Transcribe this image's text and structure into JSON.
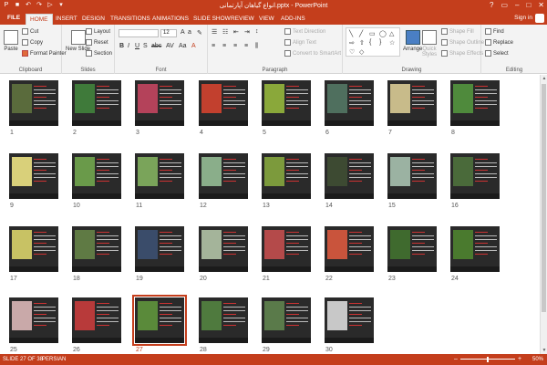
{
  "window": {
    "title": "انواع گیاهان آپارتمانی.pptx - PowerPoint",
    "controls": [
      "?",
      "▭",
      "–",
      "□",
      "✕"
    ]
  },
  "tabs": [
    "FILE",
    "HOME",
    "INSERT",
    "DESIGN",
    "TRANSITIONS",
    "ANIMATIONS",
    "SLIDE SHOW",
    "REVIEW",
    "VIEW",
    "ADD-INS"
  ],
  "signin": "Sign in",
  "ribbon": {
    "clipboard": {
      "label": "Clipboard",
      "paste": "Paste",
      "cut": "Cut",
      "copy": "Copy",
      "format_painter": "Format Painter"
    },
    "slides": {
      "label": "Slides",
      "new_slide": "New Slide",
      "layout": "Layout",
      "reset": "Reset",
      "section": "Section"
    },
    "font": {
      "label": "Font",
      "size": "12",
      "buttons": [
        "B",
        "I",
        "U",
        "S",
        "abc",
        "AV",
        "Aa",
        "A"
      ]
    },
    "paragraph": {
      "label": "Paragraph",
      "text_direction": "Text Direction",
      "align_text": "Align Text",
      "convert": "Convert to SmartArt"
    },
    "drawing": {
      "label": "Drawing",
      "arrange": "Arrange",
      "quick_styles": "Quick Styles",
      "shape_fill": "Shape Fill",
      "shape_outline": "Shape Outline",
      "shape_effects": "Shape Effects"
    },
    "editing": {
      "label": "Editing",
      "find": "Find",
      "replace": "Replace",
      "select": "Select"
    }
  },
  "slides": [
    {
      "n": "1",
      "color": "#5a6b3c"
    },
    {
      "n": "2",
      "color": "#3f7a3a"
    },
    {
      "n": "3",
      "color": "#b4425a"
    },
    {
      "n": "4",
      "color": "#c2402e"
    },
    {
      "n": "5",
      "color": "#8aa83a"
    },
    {
      "n": "6",
      "color": "#4f6f5e"
    },
    {
      "n": "7",
      "color": "#c8bb8a"
    },
    {
      "n": "8",
      "color": "#4f8a3c"
    },
    {
      "n": "9",
      "color": "#d9d07a"
    },
    {
      "n": "10",
      "color": "#6a9a4a"
    },
    {
      "n": "11",
      "color": "#7aa45a"
    },
    {
      "n": "12",
      "color": "#8aae8a"
    },
    {
      "n": "13",
      "color": "#7c9a3c"
    },
    {
      "n": "14",
      "color": "#3d4a32"
    },
    {
      "n": "15",
      "color": "#9bb2a2"
    },
    {
      "n": "16",
      "color": "#4a6a3a"
    },
    {
      "n": "17",
      "color": "#c8c264"
    },
    {
      "n": "18",
      "color": "#5f7a44"
    },
    {
      "n": "19",
      "color": "#3a4c6a"
    },
    {
      "n": "20",
      "color": "#a4b49a"
    },
    {
      "n": "21",
      "color": "#b44a4a"
    },
    {
      "n": "22",
      "color": "#c9543c"
    },
    {
      "n": "23",
      "color": "#3f6a2e"
    },
    {
      "n": "24",
      "color": "#4a7a2e"
    },
    {
      "n": "25",
      "color": "#c9a9a9"
    },
    {
      "n": "26",
      "color": "#b83a3a"
    },
    {
      "n": "27",
      "color": "#5a8a3a"
    },
    {
      "n": "28",
      "color": "#4f7a3e"
    },
    {
      "n": "29",
      "color": "#5a7a4a"
    },
    {
      "n": "30",
      "color": "#c8c8c8"
    }
  ],
  "selected_slide": "27",
  "status": {
    "slide_info": "SLIDE 27 OF 38",
    "language": "PERSIAN",
    "zoom": "50%",
    "zoom_level": 0.5
  }
}
